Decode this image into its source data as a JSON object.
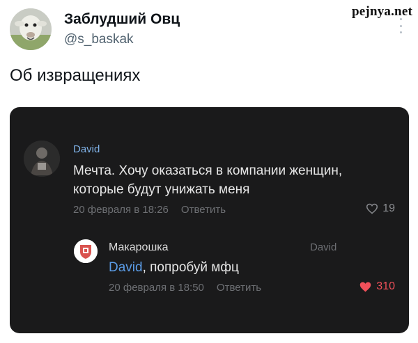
{
  "watermark": "pejnya.net",
  "tweet": {
    "display_name": "Заблудший Овц",
    "handle": "@s_baskak",
    "text": "Об извращениях"
  },
  "screenshot": {
    "comment": {
      "author": "David",
      "text": "Мечта. Хочу оказаться в компании женщин, которые будут унижать меня",
      "date": "20 февраля в 18:26",
      "reply_label": "Ответить",
      "likes": "19"
    },
    "reply": {
      "author": "Макарошка",
      "reply_to": "David",
      "mention": "David",
      "text": ", попробуй мфц",
      "date": "20 февраля в 18:50",
      "reply_label": "Ответить",
      "likes": "310"
    }
  },
  "colors": {
    "card_bg": "#1a1a1b",
    "link": "#5b9ce6",
    "like_active": "#f0505a"
  }
}
